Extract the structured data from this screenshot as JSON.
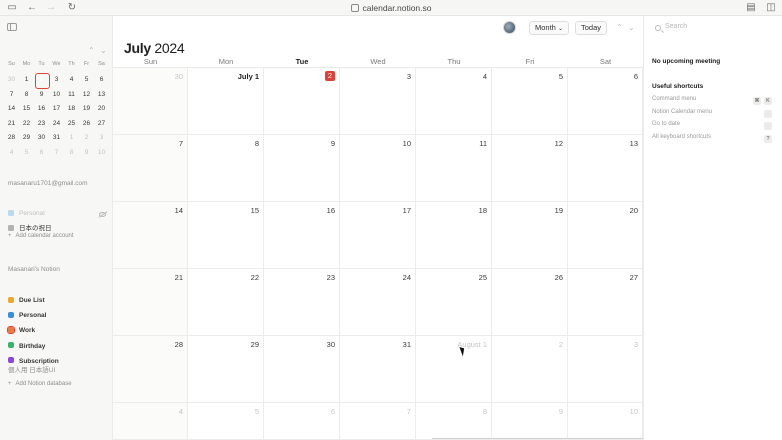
{
  "browser": {
    "url": "calendar.notion.so"
  },
  "header": {
    "view_label": "Month",
    "view_caret": "⌄",
    "today_label": "Today",
    "prev": "⌃",
    "next": "⌄",
    "month": "July",
    "year": "2024"
  },
  "mini_calendar": {
    "weekdays": [
      "Su",
      "Mo",
      "Tu",
      "We",
      "Th",
      "Fr",
      "Sa"
    ],
    "days": [
      {
        "d": "30",
        "muted": true
      },
      {
        "d": "1"
      },
      {
        "d": "2",
        "today": true
      },
      {
        "d": "3"
      },
      {
        "d": "4"
      },
      {
        "d": "5"
      },
      {
        "d": "6"
      },
      {
        "d": "7"
      },
      {
        "d": "8"
      },
      {
        "d": "9"
      },
      {
        "d": "10"
      },
      {
        "d": "11"
      },
      {
        "d": "12"
      },
      {
        "d": "13"
      },
      {
        "d": "14"
      },
      {
        "d": "15"
      },
      {
        "d": "16"
      },
      {
        "d": "17"
      },
      {
        "d": "18"
      },
      {
        "d": "19"
      },
      {
        "d": "20"
      },
      {
        "d": "21"
      },
      {
        "d": "22"
      },
      {
        "d": "23"
      },
      {
        "d": "24"
      },
      {
        "d": "25"
      },
      {
        "d": "26"
      },
      {
        "d": "27"
      },
      {
        "d": "28"
      },
      {
        "d": "29"
      },
      {
        "d": "30"
      },
      {
        "d": "31"
      },
      {
        "d": "1",
        "muted": true
      },
      {
        "d": "2",
        "muted": true
      },
      {
        "d": "3",
        "muted": true
      },
      {
        "d": "4",
        "muted": true
      },
      {
        "d": "5",
        "muted": true
      },
      {
        "d": "6",
        "muted": true
      },
      {
        "d": "7",
        "muted": true
      },
      {
        "d": "8",
        "muted": true
      },
      {
        "d": "9",
        "muted": true
      },
      {
        "d": "10",
        "muted": true
      }
    ]
  },
  "sidebar": {
    "account_email": "masanaru1701@gmail.com",
    "account_calendars": [
      {
        "label": "Personal",
        "color": "#b9d9ef",
        "dim": true
      },
      {
        "label": "日本の祝日",
        "color": "#b3b3b3"
      }
    ],
    "add_calendar_account": "Add calendar account",
    "notion_section": "Masanari's Notion",
    "notion_calendars": [
      {
        "label": "Due List",
        "color": "#f0a52b"
      },
      {
        "label": "Personal",
        "color": "#3a8fd9"
      },
      {
        "label": "Work",
        "color": "#f07a3a",
        "ring": true
      },
      {
        "label": "Birthday",
        "color": "#3bb36b"
      },
      {
        "label": "Subscription",
        "color": "#8b46e0"
      }
    ],
    "workspace_label": "個人用 日本語UI",
    "add_notion_database": "Add Notion database",
    "add_symbol": "+"
  },
  "calendar": {
    "weekdays": [
      "Sun",
      "Mon",
      "Tue",
      "Wed",
      "Thu",
      "Fri",
      "Sat"
    ],
    "current_weekday_index": 2,
    "weeks": [
      [
        {
          "d": "30",
          "muted": true
        },
        {
          "d": "July 1",
          "strong": true
        },
        {
          "d": "2",
          "today": true
        },
        {
          "d": "3"
        },
        {
          "d": "4"
        },
        {
          "d": "5"
        },
        {
          "d": "6"
        }
      ],
      [
        {
          "d": "7"
        },
        {
          "d": "8"
        },
        {
          "d": "9"
        },
        {
          "d": "10"
        },
        {
          "d": "11"
        },
        {
          "d": "12"
        },
        {
          "d": "13"
        }
      ],
      [
        {
          "d": "14"
        },
        {
          "d": "15"
        },
        {
          "d": "16"
        },
        {
          "d": "17"
        },
        {
          "d": "18"
        },
        {
          "d": "19"
        },
        {
          "d": "20"
        }
      ],
      [
        {
          "d": "21"
        },
        {
          "d": "22"
        },
        {
          "d": "23"
        },
        {
          "d": "24"
        },
        {
          "d": "25"
        },
        {
          "d": "26"
        },
        {
          "d": "27"
        }
      ],
      [
        {
          "d": "28"
        },
        {
          "d": "29"
        },
        {
          "d": "30"
        },
        {
          "d": "31"
        },
        {
          "d": "August 1",
          "muted": true
        },
        {
          "d": "2",
          "muted": true
        },
        {
          "d": "3",
          "muted": true
        }
      ],
      [
        {
          "d": "4",
          "muted": true
        },
        {
          "d": "5",
          "muted": true
        },
        {
          "d": "6",
          "muted": true
        },
        {
          "d": "7",
          "muted": true
        },
        {
          "d": "8",
          "muted": true
        },
        {
          "d": "9",
          "muted": true
        },
        {
          "d": "10",
          "muted": true
        }
      ]
    ]
  },
  "right_panel": {
    "search_placeholder": "Search",
    "no_meeting": "No upcoming meeting",
    "shortcuts_title": "Useful shortcuts",
    "shortcuts": [
      {
        "label": "Command menu",
        "keys": [
          "⌘",
          "K"
        ]
      },
      {
        "label": "Notion Calendar menu",
        "keys": [
          ""
        ]
      },
      {
        "label": "Go to date",
        "keys": [
          ""
        ]
      },
      {
        "label": "All keyboard shortcuts",
        "keys": [
          "?"
        ]
      }
    ]
  },
  "colors": {
    "accent": "#e0403a"
  }
}
